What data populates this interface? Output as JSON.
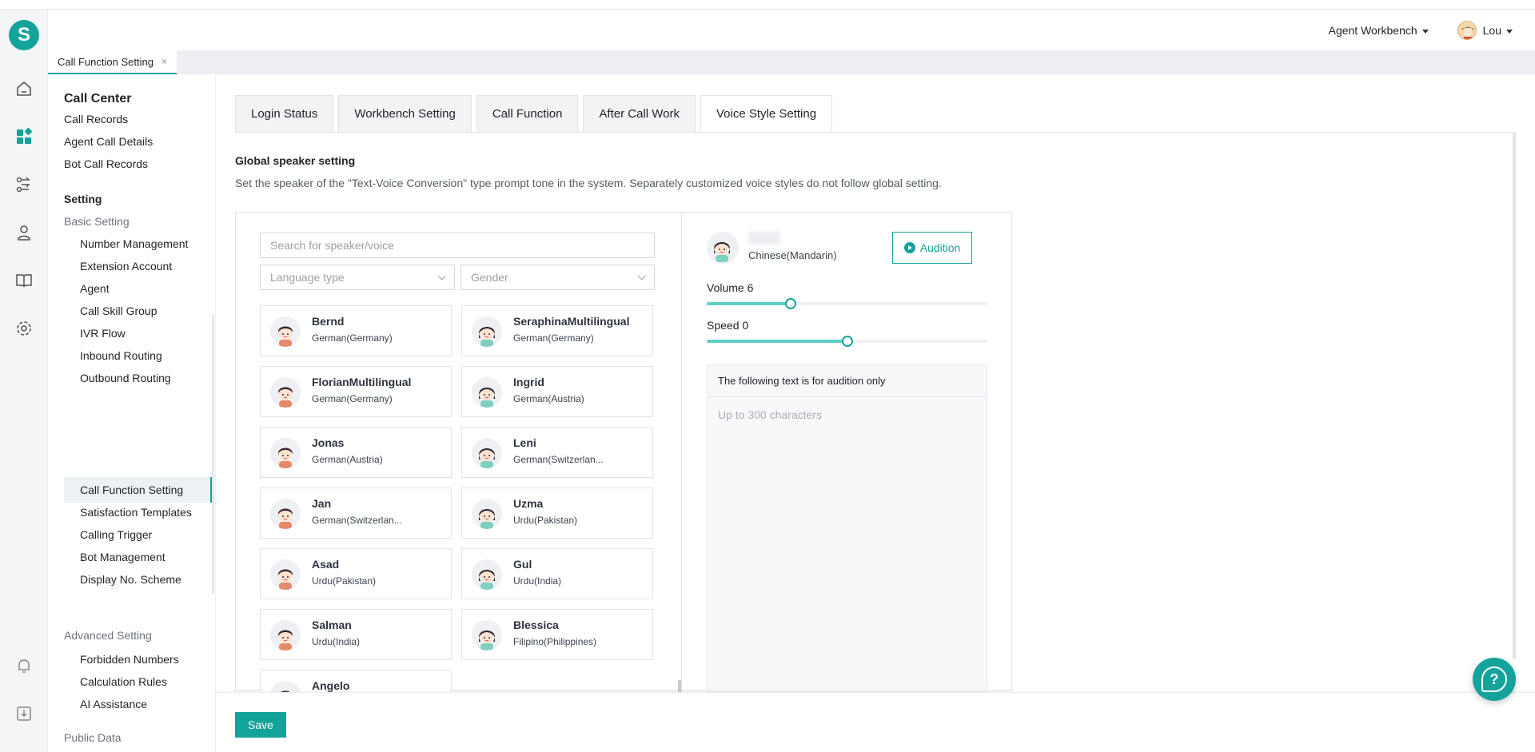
{
  "logo_letter": "S",
  "header": {
    "workbench_label": "Agent Workbench",
    "user_name": "Lou"
  },
  "page_tab": {
    "label": "Call Function Setting",
    "close": "×"
  },
  "sidebar": {
    "title": "Call Center",
    "records": [
      "Call Records",
      "Agent Call Details",
      "Bot Call Records"
    ],
    "setting_label": "Setting",
    "basic_label": "Basic Setting",
    "basic_items": [
      "Number Management",
      "Extension Account",
      "Agent",
      "Call Skill Group",
      "IVR Flow",
      "Inbound Routing",
      "Outbound Routing",
      "Call Function Setting",
      "Satisfaction Templates",
      "Calling Trigger",
      "Bot Management",
      "Display No. Scheme"
    ],
    "advanced_label": "Advanced Setting",
    "advanced_items": [
      "Forbidden Numbers",
      "Calculation Rules",
      "AI Assistance"
    ],
    "public_label": "Public Data"
  },
  "tabs": [
    "Login Status",
    "Workbench Setting",
    "Call Function",
    "After Call Work",
    "Voice Style Setting"
  ],
  "section": {
    "title": "Global speaker setting",
    "description": "Set the speaker of the \"Text-Voice Conversion\" type prompt tone in the system. Separately customized voice styles do not follow global setting."
  },
  "filters": {
    "search_placeholder": "Search for speaker/voice",
    "language_placeholder": "Language type",
    "gender_placeholder": "Gender"
  },
  "speakers": [
    {
      "name": "Bernd",
      "lang": "German(Germany)",
      "gender": "male"
    },
    {
      "name": "SeraphinaMultilingual",
      "lang": "German(Germany)",
      "gender": "female"
    },
    {
      "name": "FlorianMultilingual",
      "lang": "German(Germany)",
      "gender": "male"
    },
    {
      "name": "Ingrid",
      "lang": "German(Austria)",
      "gender": "female"
    },
    {
      "name": "Jonas",
      "lang": "German(Austria)",
      "gender": "male"
    },
    {
      "name": "Leni",
      "lang": "German(Switzerlan...",
      "gender": "female"
    },
    {
      "name": "Jan",
      "lang": "German(Switzerlan...",
      "gender": "male"
    },
    {
      "name": "Uzma",
      "lang": "Urdu(Pakistan)",
      "gender": "female"
    },
    {
      "name": "Asad",
      "lang": "Urdu(Pakistan)",
      "gender": "male"
    },
    {
      "name": "Gul",
      "lang": "Urdu(India)",
      "gender": "female"
    },
    {
      "name": "Salman",
      "lang": "Urdu(India)",
      "gender": "male"
    },
    {
      "name": "Blessica",
      "lang": "Filipino(Philippines)",
      "gender": "female"
    },
    {
      "name": "Angelo",
      "lang": "",
      "gender": "male"
    }
  ],
  "selected": {
    "lang": "Chinese(Mandarin)",
    "audition_label": "Audition",
    "volume_label": "Volume 6",
    "volume_fraction": 0.3,
    "speed_label": "Speed 0",
    "speed_fraction": 0.5,
    "text_header": "The following text is for audition only",
    "text_placeholder": "Up to 300 characters"
  },
  "footer": {
    "save_label": "Save"
  },
  "colors": {
    "accent": "#14a39a"
  }
}
